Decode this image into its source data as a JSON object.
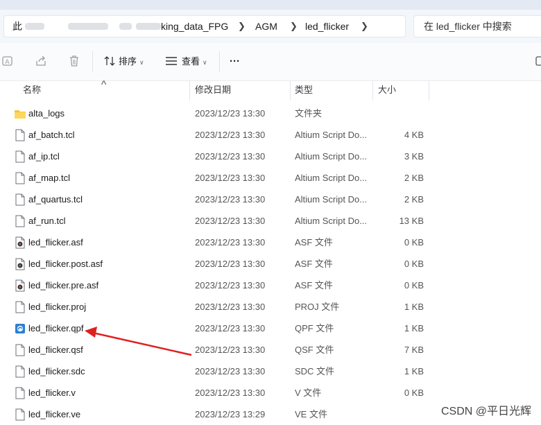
{
  "breadcrumb": {
    "root_visible": "此",
    "path_tail_visible": "king_data_FPG",
    "segments": [
      "AGM",
      "led_flicker"
    ]
  },
  "search": {
    "placeholder": "在 led_flicker 中搜索"
  },
  "toolbar": {
    "sort_label": "排序",
    "view_label": "查看",
    "more_label": "···"
  },
  "columns": {
    "name": "名称",
    "date": "修改日期",
    "type": "类型",
    "size": "大小"
  },
  "files": [
    {
      "name": "alta_logs",
      "date": "2023/12/23 13:30",
      "type": "文件夹",
      "size": "",
      "icon": "folder-icon"
    },
    {
      "name": "af_batch.tcl",
      "date": "2023/12/23 13:30",
      "type": "Altium Script Do...",
      "size": "4 KB",
      "icon": "file-icon"
    },
    {
      "name": "af_ip.tcl",
      "date": "2023/12/23 13:30",
      "type": "Altium Script Do...",
      "size": "3 KB",
      "icon": "file-icon"
    },
    {
      "name": "af_map.tcl",
      "date": "2023/12/23 13:30",
      "type": "Altium Script Do...",
      "size": "2 KB",
      "icon": "file-icon"
    },
    {
      "name": "af_quartus.tcl",
      "date": "2023/12/23 13:30",
      "type": "Altium Script Do...",
      "size": "2 KB",
      "icon": "file-icon"
    },
    {
      "name": "af_run.tcl",
      "date": "2023/12/23 13:30",
      "type": "Altium Script Do...",
      "size": "13 KB",
      "icon": "file-icon"
    },
    {
      "name": "led_flicker.asf",
      "date": "2023/12/23 13:30",
      "type": "ASF 文件",
      "size": "0 KB",
      "icon": "asf-file-icon"
    },
    {
      "name": "led_flicker.post.asf",
      "date": "2023/12/23 13:30",
      "type": "ASF 文件",
      "size": "0 KB",
      "icon": "asf-file-icon"
    },
    {
      "name": "led_flicker.pre.asf",
      "date": "2023/12/23 13:30",
      "type": "ASF 文件",
      "size": "0 KB",
      "icon": "asf-file-icon"
    },
    {
      "name": "led_flicker.proj",
      "date": "2023/12/23 13:30",
      "type": "PROJ 文件",
      "size": "1 KB",
      "icon": "file-icon"
    },
    {
      "name": "led_flicker.qpf",
      "date": "2023/12/23 13:30",
      "type": "QPF 文件",
      "size": "1 KB",
      "icon": "quartus-project-icon"
    },
    {
      "name": "led_flicker.qsf",
      "date": "2023/12/23 13:30",
      "type": "QSF 文件",
      "size": "7 KB",
      "icon": "file-icon"
    },
    {
      "name": "led_flicker.sdc",
      "date": "2023/12/23 13:30",
      "type": "SDC 文件",
      "size": "1 KB",
      "icon": "file-icon"
    },
    {
      "name": "led_flicker.v",
      "date": "2023/12/23 13:30",
      "type": "V 文件",
      "size": "0 KB",
      "icon": "file-icon"
    },
    {
      "name": "led_flicker.ve",
      "date": "2023/12/23 13:29",
      "type": "VE 文件",
      "size": "",
      "icon": "file-icon"
    }
  ],
  "annotation": {
    "target_file": "led_flicker.qpf",
    "arrow_color": "#e02020"
  },
  "watermark": "CSDN @平日光辉"
}
